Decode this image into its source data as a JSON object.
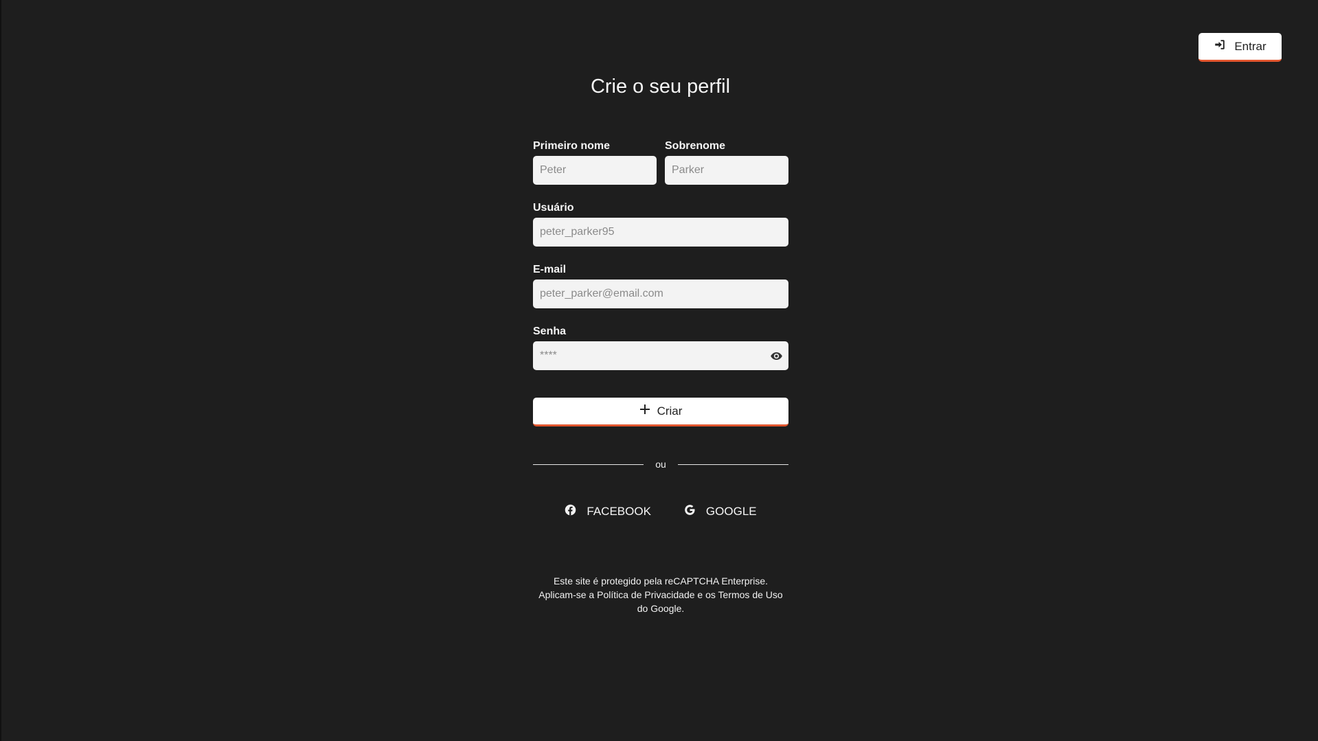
{
  "header": {
    "login_label": "Entrar"
  },
  "page_title": "Crie o seu perfil",
  "form": {
    "first_name": {
      "label": "Primeiro nome",
      "placeholder": "Peter",
      "value": ""
    },
    "last_name": {
      "label": "Sobrenome",
      "placeholder": "Parker",
      "value": ""
    },
    "username": {
      "label": "Usuário",
      "placeholder": "peter_parker95",
      "value": ""
    },
    "email": {
      "label": "E-mail",
      "placeholder": "peter_parker@email.com",
      "value": ""
    },
    "password": {
      "label": "Senha",
      "placeholder": "****",
      "value": ""
    },
    "submit_label": "Criar"
  },
  "divider_text": "ou",
  "social": {
    "facebook_label": "FACEBOOK",
    "google_label": "GOOGLE"
  },
  "recaptcha": {
    "line1": "Este site é protegido pela reCAPTCHA Enterprise.",
    "prefix": "Aplicam-se a ",
    "privacy_link": "Política de Privacidade",
    "middle": " e os ",
    "terms_link": "Termos de Uso",
    "suffix": " do Google."
  },
  "colors": {
    "background": "#1e1e1e",
    "accent": "#e2562f",
    "button_bg": "#ffffff",
    "input_bg": "#f3f3f3"
  }
}
